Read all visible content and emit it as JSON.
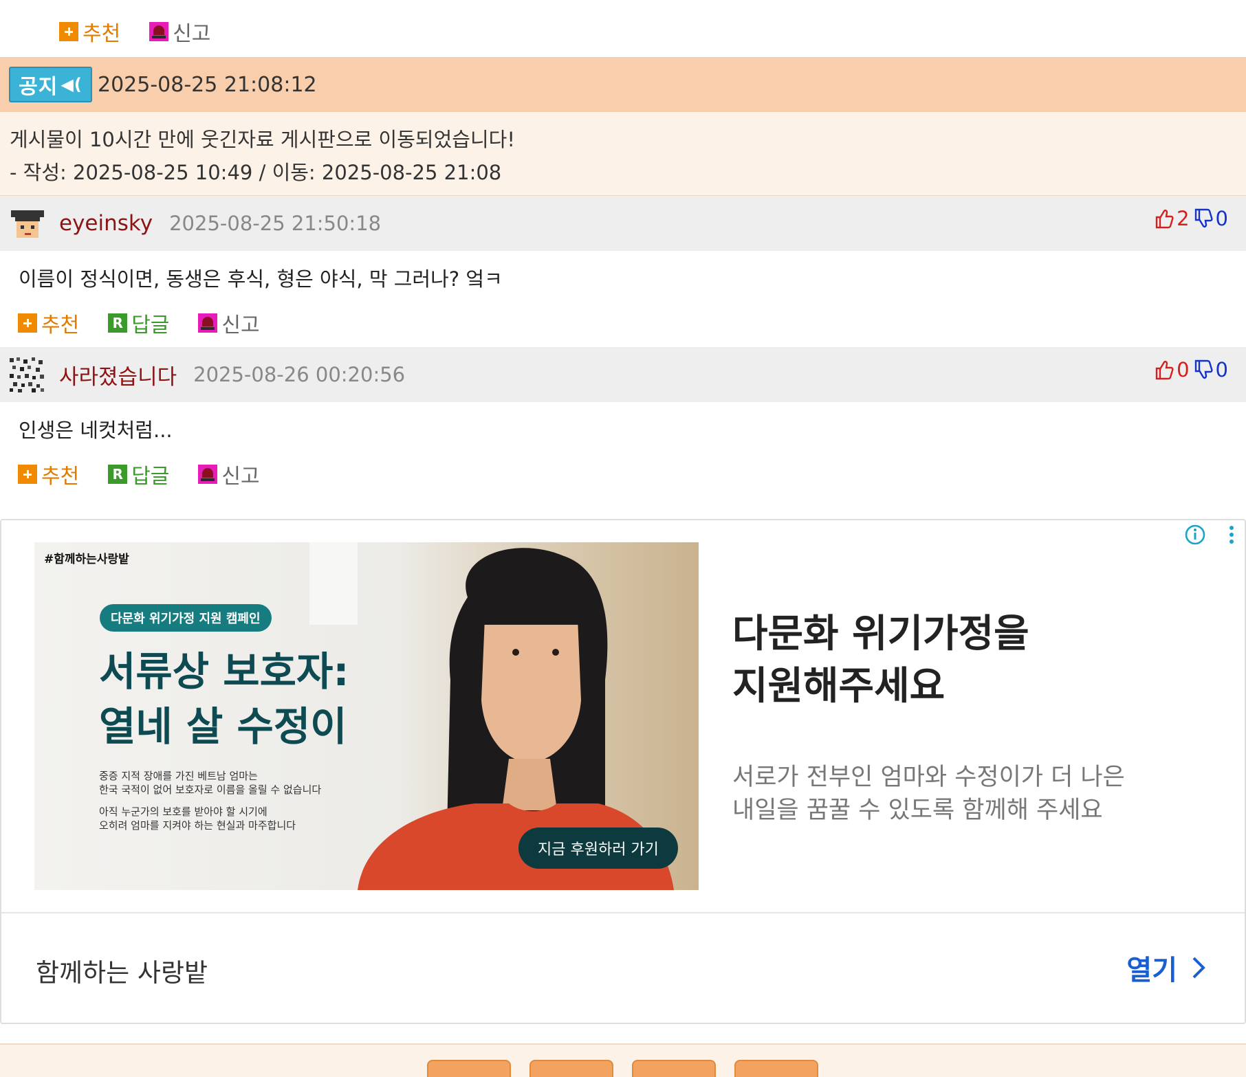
{
  "top_actions": {
    "recommend": "추천",
    "report": "신고"
  },
  "notice": {
    "badge": "공지",
    "time": "2025-08-25 21:08:12",
    "line1": "게시물이 10시간 만에 웃긴자료 게시판으로 이동되었습니다!",
    "line2": "- 작성: 2025-08-25 10:49 / 이동: 2025-08-25 21:08"
  },
  "comments": [
    {
      "author": "eyeinsky",
      "time": "2025-08-25 21:50:18",
      "up": "2",
      "down": "0",
      "text": "이름이 정식이면, 동생은 후식, 형은 야식, 막 그러나? 엌ㅋ",
      "recommend": "추천",
      "reply": "답글",
      "report": "신고"
    },
    {
      "author": "사라졌습니다",
      "time": "2025-08-26 00:20:56",
      "up": "0",
      "down": "0",
      "text": "인생은 네컷처럼...",
      "recommend": "추천",
      "reply": "답글",
      "report": "신고"
    }
  ],
  "ad": {
    "brand": "#함께하는사랑밭",
    "pill": "다문화 위기가정 지원 캠페인",
    "headline1": "서류상 보호자:",
    "headline2": "열네 살 수정이",
    "small1": "중증 지적 장애를 가진 베트남 엄마는",
    "small2": "한국 국적이 없어 보호자로 이름을 올릴 수 없습니다",
    "small3": "아직 누군가의 보호를 받아야 할 시기에",
    "small4": "오히려 엄마를 지켜야 하는 현실과 마주합니다",
    "cta": "지금 후원하러 가기",
    "title1": "다문화 위기가정을",
    "title2": "지원해주세요",
    "desc1": "서로가 전부인 엄마와 수정이가 더 나은",
    "desc2": "내일을 꿈꿀 수 있도록 함께해 주세요",
    "advertiser": "함께하는 사랑밭",
    "open": "열기"
  },
  "colors": {
    "accent_orange": "#e07b00",
    "author": "#8b1414",
    "vote_up": "#d4201c",
    "vote_down": "#1532c8",
    "notice_bg": "#f8ceac"
  }
}
